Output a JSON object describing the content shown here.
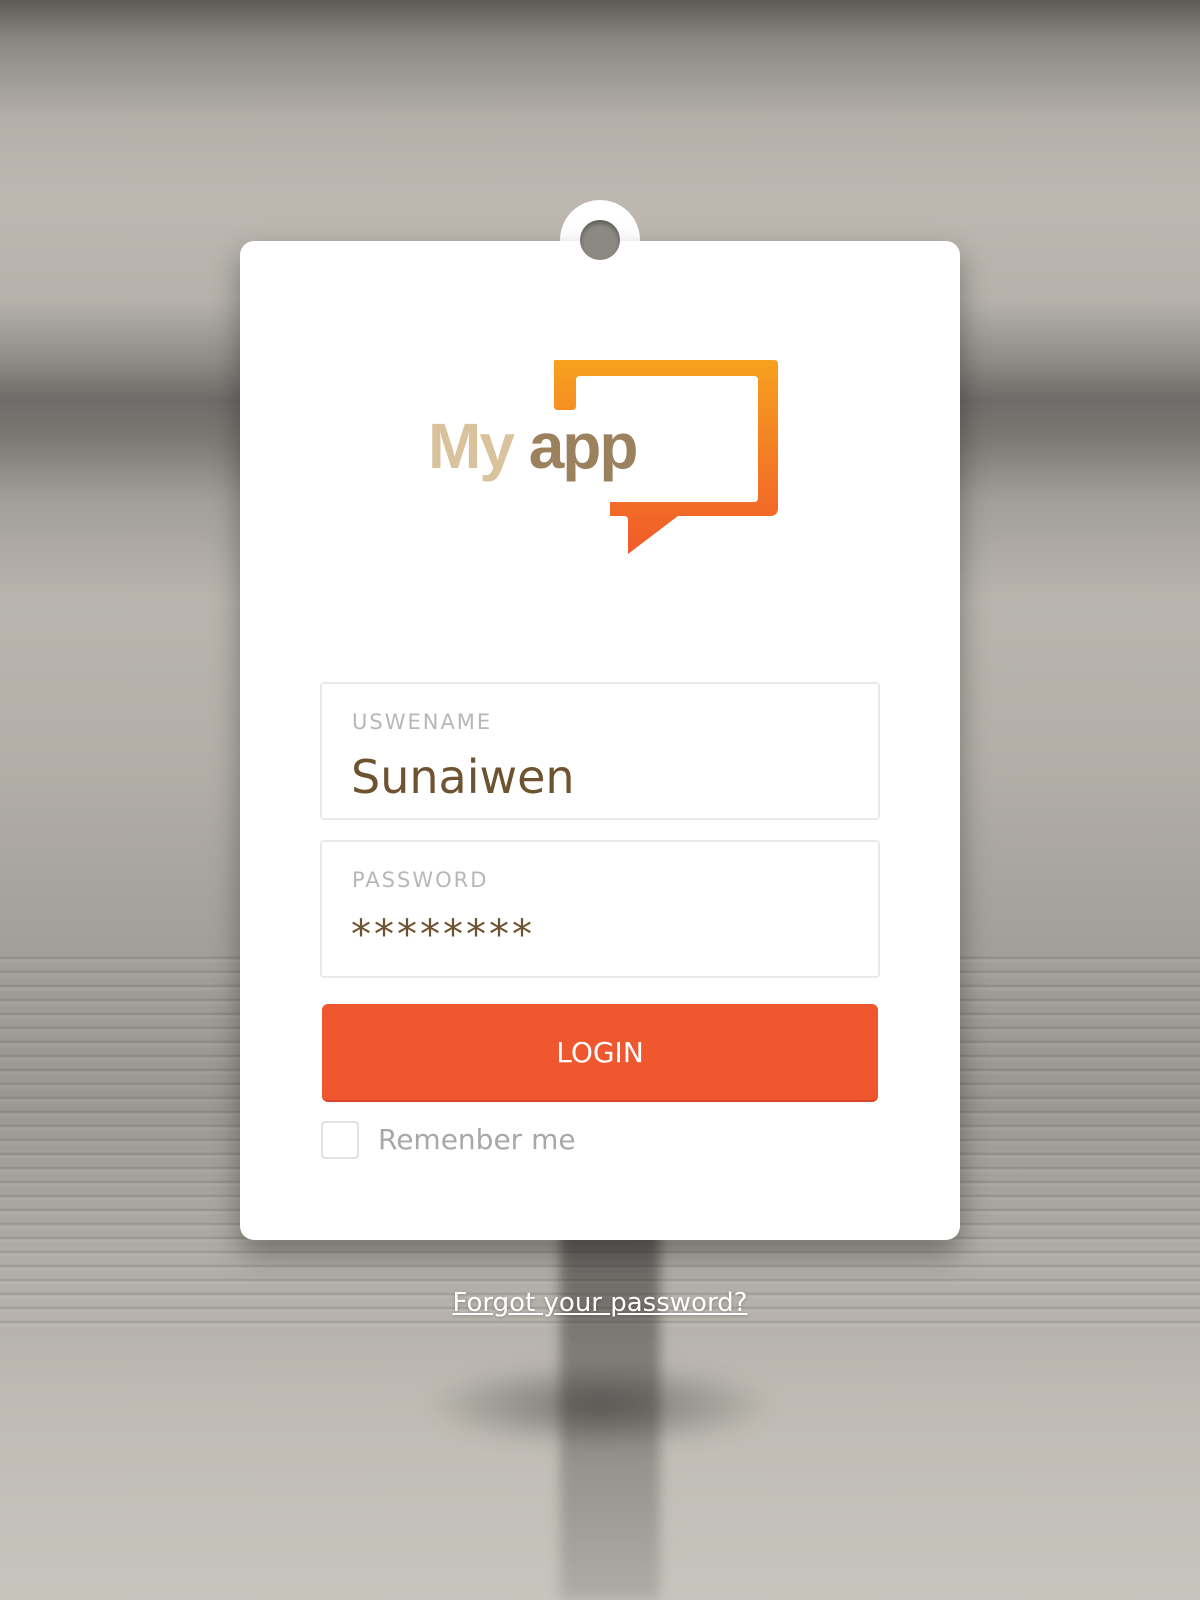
{
  "logo": {
    "my": "My",
    "app": "app",
    "icon": "speech-bubble-icon",
    "gradient_top": "#f7a11f",
    "gradient_bottom": "#f05a2a"
  },
  "login_form": {
    "username": {
      "label": "USWENAME",
      "value": "Sunaiwen"
    },
    "password": {
      "label": "PASSWORD",
      "value": "********"
    },
    "login_button_label": "LOGIN",
    "remember_me": {
      "label": "Remenber me",
      "checked": false
    }
  },
  "forgot_password_link": "Forgot your password?",
  "colors": {
    "accent": "#ef572f",
    "value_text": "#6d5330",
    "label_text": "#b7b7b7"
  }
}
